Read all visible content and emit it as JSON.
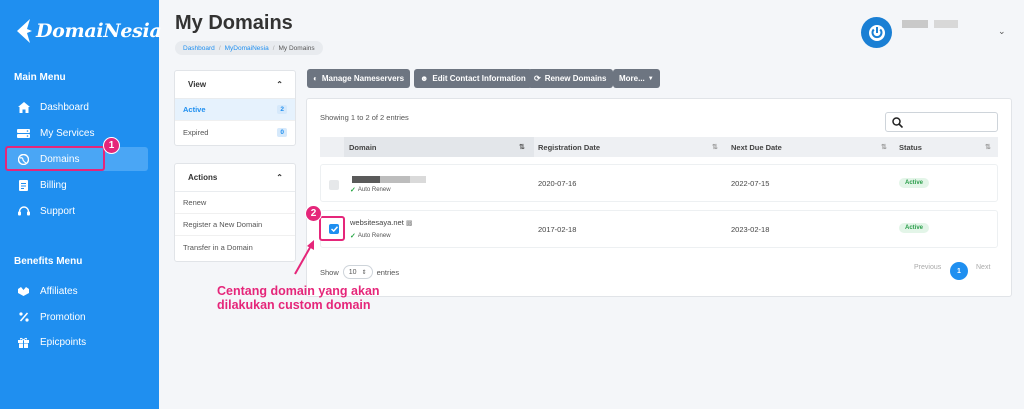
{
  "brand": {
    "name": "DomaiNesia"
  },
  "sidebar": {
    "main_title": "Main Menu",
    "main_items": [
      {
        "label": "Dashboard",
        "icon": "home-icon"
      },
      {
        "label": "My Services",
        "icon": "server-icon"
      },
      {
        "label": "Domains",
        "icon": "globe-icon",
        "active": true
      },
      {
        "label": "Billing",
        "icon": "invoice-icon"
      },
      {
        "label": "Support",
        "icon": "headset-icon"
      }
    ],
    "benefits_title": "Benefits Menu",
    "benefit_items": [
      {
        "label": "Affiliates",
        "icon": "affiliates-icon"
      },
      {
        "label": "Promotion",
        "icon": "percent-icon"
      },
      {
        "label": "Epicpoints",
        "icon": "gift-icon"
      }
    ]
  },
  "header": {
    "title": "My Domains",
    "breadcrumb": [
      "Dashboard",
      "MyDomaiNesia",
      "My Domains"
    ]
  },
  "view_panel": {
    "title": "View",
    "items": [
      {
        "label": "Active",
        "count": "2",
        "active": true
      },
      {
        "label": "Expired",
        "count": "0"
      }
    ]
  },
  "actions_panel": {
    "title": "Actions",
    "items": [
      "Renew",
      "Register a New Domain",
      "Transfer in a Domain"
    ]
  },
  "toolbar": {
    "manage_ns": "Manage Nameservers",
    "edit_contact": "Edit Contact Information",
    "renew": "Renew Domains",
    "more": "More..."
  },
  "table": {
    "showing": "Showing 1 to 2 of 2 entries",
    "columns": [
      "Domain",
      "Registration Date",
      "Next Due Date",
      "Status"
    ],
    "rows": [
      {
        "domain": "",
        "auto_renew": "Auto Renew",
        "registration": "2020-07-16",
        "due": "2022-07-15",
        "status": "Active",
        "checked": false
      },
      {
        "domain": "websitesaya.net",
        "auto_renew": "Auto Renew",
        "registration": "2017-02-18",
        "due": "2023-02-18",
        "status": "Active",
        "checked": true
      }
    ],
    "show_label": "Show",
    "page_size": "10",
    "entries_label": "entries",
    "pagination": {
      "previous": "Previous",
      "current": "1",
      "next": "Next"
    }
  },
  "annotations": {
    "step1": "1",
    "step2": "2",
    "instruction_line1": "Centang domain yang akan",
    "instruction_line2": "dilakukan custom domain"
  },
  "colors": {
    "sidebar": "#1f8ff0",
    "highlight": "#e5267a",
    "status_green": "#2a9d4a"
  }
}
